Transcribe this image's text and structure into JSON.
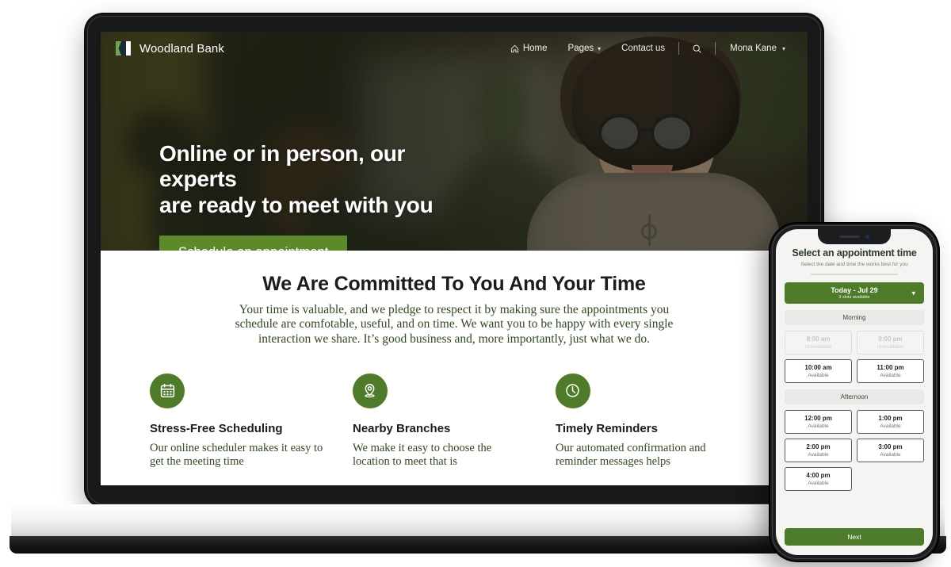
{
  "site": {
    "brand": {
      "name": "Woodland Bank",
      "logo_icon": "woodland-flag-logo"
    },
    "nav": {
      "home": "Home",
      "home_icon": "home-icon",
      "pages": "Pages",
      "pages_caret_icon": "chevron-down-icon",
      "contact": "Contact us",
      "search_icon": "search-icon",
      "user_name": "Mona Kane",
      "user_caret_icon": "chevron-down-icon"
    },
    "hero": {
      "title_line1": "Online or in person, our experts",
      "title_line2": "are ready to meet with you",
      "cta_label": "Schedule an appointment",
      "cta_color": "#5c8a2b"
    },
    "section": {
      "title": "We Are Committed To You And Your Time",
      "paragraph": "Your time is valuable, and we pledge to respect it by making sure the appointments you schedule are comfotable, useful, and on time. We want you to be happy with every single interaction we share. It’s good business and, more importantly, just what we do.",
      "accent_color": "#2f4a1e"
    },
    "features": [
      {
        "icon": "calendar-icon",
        "title": "Stress-Free Scheduling",
        "text": "Our online scheduler makes it easy to get the meeting time"
      },
      {
        "icon": "map-pin-icon",
        "title": "Nearby Branches",
        "text": "We make it easy to choose the location to meet that is"
      },
      {
        "icon": "clock-icon",
        "title": "Timely Reminders",
        "text": "Our automated confirmation and reminder messages helps"
      }
    ]
  },
  "phone": {
    "title": "Select an appointment time",
    "subtitle": "Select the date and time the works best for you",
    "date_selector": {
      "label": "Today - Jul 29",
      "slots_note": "3 slots available",
      "caret_icon": "chevron-down-icon",
      "color": "#4e7b29"
    },
    "sections": [
      {
        "heading": "Morning",
        "slots": [
          {
            "time": "8:00 am",
            "state": "Unavailable",
            "available": false
          },
          {
            "time": "9:00 pm",
            "state": "Unavailable",
            "available": false
          },
          {
            "time": "10:00 am",
            "state": "Available",
            "available": true
          },
          {
            "time": "11:00 pm",
            "state": "Available",
            "available": true
          }
        ]
      },
      {
        "heading": "Afternoon",
        "slots": [
          {
            "time": "12:00 pm",
            "state": "Available",
            "available": true
          },
          {
            "time": "1:00 pm",
            "state": "Available",
            "available": true
          },
          {
            "time": "2:00 pm",
            "state": "Available",
            "available": true
          },
          {
            "time": "3:00 pm",
            "state": "Available",
            "available": true
          },
          {
            "time": "4:00 pm",
            "state": "Available",
            "available": true
          }
        ]
      }
    ],
    "next_label": "Next"
  }
}
